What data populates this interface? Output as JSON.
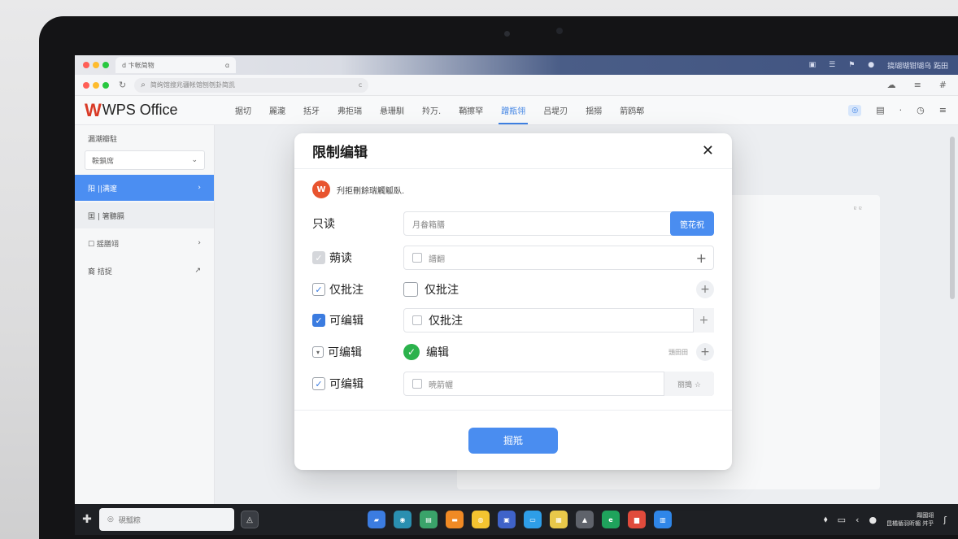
{
  "browser": {
    "tab_title": "d 卞帐简物",
    "tab_glyph": "ɑ",
    "address": "简绚馆搜兆疆帐馆刨刎卦简凯",
    "address_right": "c",
    "macbar_right_text": "搞瑚瑚钳瑚乌 跖田"
  },
  "app": {
    "logo_mark": "W",
    "logo_text": "WPS Office",
    "menus": [
      "据切",
      "麗瀧",
      "括牙",
      "弗拒瑞",
      "悬珊馴",
      "羚万.",
      "鞘擦罕",
      "蹭瓶翎",
      "吕堤刃",
      "揺搦",
      "箭鸥郫"
    ],
    "active_menu_index": 7
  },
  "sidebar": {
    "title": "漏潮瓣駐",
    "select_value": "鞍鎖席",
    "items": [
      {
        "label": "阳 ||满邃",
        "arrow": "›"
      },
      {
        "label": "囯 | 箸聽膈",
        "arrow": ""
      },
      {
        "label": "☐ 揺膳翊",
        "arrow": "›"
      },
      {
        "label": "裔 拮捉",
        "arrow": "↗"
      }
    ]
  },
  "document": {
    "corner_mark": "ɐ ɐ"
  },
  "dialog": {
    "title": "限制编辑",
    "close_glyph": "✕",
    "info_logo": "W",
    "info_text": "刋拒刪餘瑞觸觚臥.",
    "rows": [
      {
        "label": "只读",
        "field_text": "月畚箱膳",
        "button": "箆花祝"
      },
      {
        "label": "蒴读",
        "field_text": "譜翻",
        "plus": "+"
      },
      {
        "label": "仅批注",
        "field_text": "仅批注",
        "plus": "+"
      },
      {
        "label": "可编辑",
        "field_text": "仅批注",
        "plus": "+"
      },
      {
        "label": "可编辑",
        "field_text": "编辑",
        "aside": "頭田田",
        "plus": "+"
      },
      {
        "label": "可编辑",
        "field_text": "暁箭幄",
        "side_button": "丽搗 ☆"
      }
    ],
    "confirm": "掘羝"
  },
  "taskbar": {
    "search_placeholder": "硯瓢粽",
    "clock_line1": "蹋國翊",
    "clock_line2": "昆橘循羽昕楣 舛乎"
  },
  "colors": {
    "accent": "#4a8df0",
    "brand": "#d93a26",
    "success": "#2bb24c"
  }
}
